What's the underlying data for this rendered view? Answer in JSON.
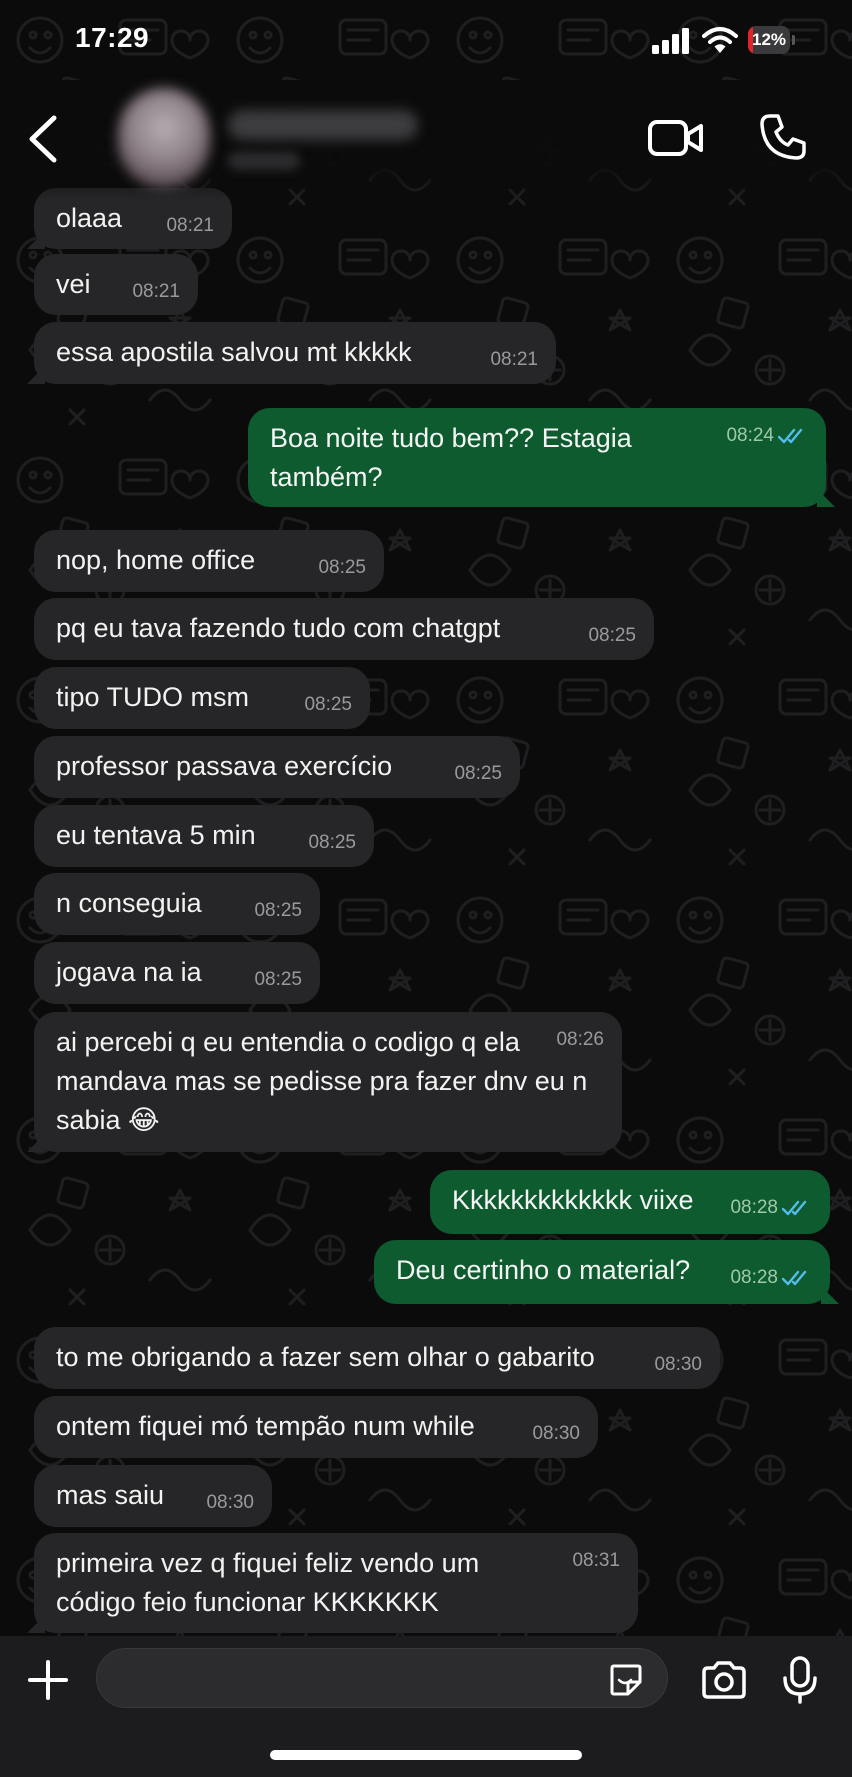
{
  "status_bar": {
    "time": "17:29",
    "battery_text": "12%",
    "battery_level": 0.12,
    "battery_color": "#e0242b"
  },
  "header": {
    "contact_name": "",
    "contact_status": "",
    "icons": [
      "chevron-left-icon",
      "video-camera-icon",
      "phone-icon"
    ]
  },
  "colors": {
    "background": "#0b0b0b",
    "incoming_bubble": "#262628",
    "outgoing_bubble": "#0d5b2f",
    "read_ticks": "#53bdeb"
  },
  "messages": [
    {
      "dir": "in",
      "text": "olaaa",
      "time": "08:21"
    },
    {
      "dir": "in",
      "text": "vei",
      "time": "08:21"
    },
    {
      "dir": "in",
      "text": "essa apostila salvou mt kkkkk",
      "time": "08:21"
    },
    {
      "dir": "out",
      "text": "Boa noite tudo bem?? Estagia também?",
      "time": "08:24",
      "read": true
    },
    {
      "dir": "in",
      "text": "nop, home office",
      "time": "08:25"
    },
    {
      "dir": "in",
      "text": "pq eu tava fazendo tudo com chatgpt",
      "time": "08:25"
    },
    {
      "dir": "in",
      "text": "tipo TUDO msm",
      "time": "08:25"
    },
    {
      "dir": "in",
      "text": "professor passava exercício",
      "time": "08:25"
    },
    {
      "dir": "in",
      "text": "eu tentava 5 min",
      "time": "08:25"
    },
    {
      "dir": "in",
      "text": "n conseguia",
      "time": "08:25"
    },
    {
      "dir": "in",
      "text": "jogava na ia",
      "time": "08:25"
    },
    {
      "dir": "in",
      "text": "ai percebi q eu entendia o codigo q ela mandava mas se pedisse pra fazer dnv eu n sabia 😂",
      "time": "08:26"
    },
    {
      "dir": "out",
      "text": "Kkkkkkkkkkkkk viixe",
      "time": "08:28",
      "read": true
    },
    {
      "dir": "out",
      "text": "Deu certinho o material?",
      "time": "08:28",
      "read": true
    },
    {
      "dir": "in",
      "text": "to me obrigando a fazer sem olhar o gabarito",
      "time": "08:30"
    },
    {
      "dir": "in",
      "text": "ontem fiquei mó tempão num while",
      "time": "08:30"
    },
    {
      "dir": "in",
      "text": "mas saiu",
      "time": "08:30"
    },
    {
      "dir": "in",
      "text": "primeira vez q fiquei feliz vendo um código feio funcionar KKKKKKK",
      "time": "08:31"
    }
  ],
  "composer": {
    "value": "",
    "placeholder": "",
    "icons": [
      "plus-icon",
      "sticker-icon",
      "camera-icon",
      "microphone-icon"
    ]
  }
}
